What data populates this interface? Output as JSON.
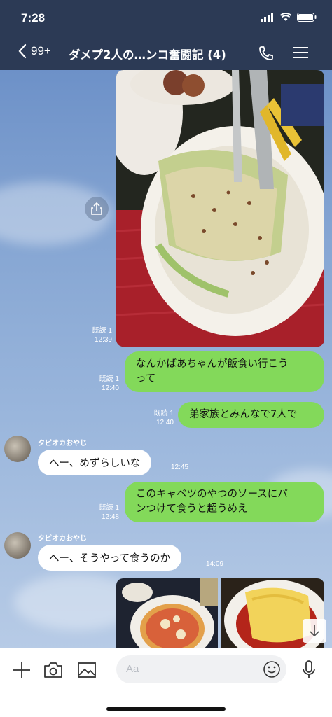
{
  "status_bar": {
    "time": "7:28"
  },
  "header": {
    "back_count": "99+",
    "title": "ダメプ2人の…ンコ奮闘記 (4)"
  },
  "messages": [
    {
      "type": "image",
      "direction": "out",
      "read": "既読 1",
      "time": "12:39",
      "description": "cabbage dish photo"
    },
    {
      "type": "text",
      "direction": "out",
      "read": "既読 1",
      "time": "12:40",
      "lines": [
        "なんかばあちゃんが飯食い行こう",
        "って"
      ]
    },
    {
      "type": "text",
      "direction": "out",
      "read": "既読 1",
      "time": "12:40",
      "lines": [
        "弟家族とみんなで7人で"
      ]
    },
    {
      "type": "text",
      "direction": "in",
      "sender": "タピオカおやじ",
      "time": "12:45",
      "lines": [
        "へー、めずらしいな"
      ]
    },
    {
      "type": "text",
      "direction": "out",
      "read": "既読 1",
      "time": "12:48",
      "lines": [
        "このキャベツのやつのソースにパ",
        "ンつけて食うと超うめえ"
      ]
    },
    {
      "type": "text",
      "direction": "in",
      "sender": "タピオカおやじ",
      "time": "14:09",
      "lines": [
        "へー、そうやって食うのか"
      ]
    },
    {
      "type": "image-pair",
      "direction": "out",
      "description": "pizza and omelette photos"
    }
  ],
  "composer": {
    "placeholder": "Aa"
  },
  "icons": [
    "back-chevron-icon",
    "phone-icon",
    "menu-icon",
    "plus-icon",
    "camera-icon",
    "image-icon",
    "emoji-icon",
    "mic-icon",
    "share-icon",
    "arrow-down-icon"
  ]
}
